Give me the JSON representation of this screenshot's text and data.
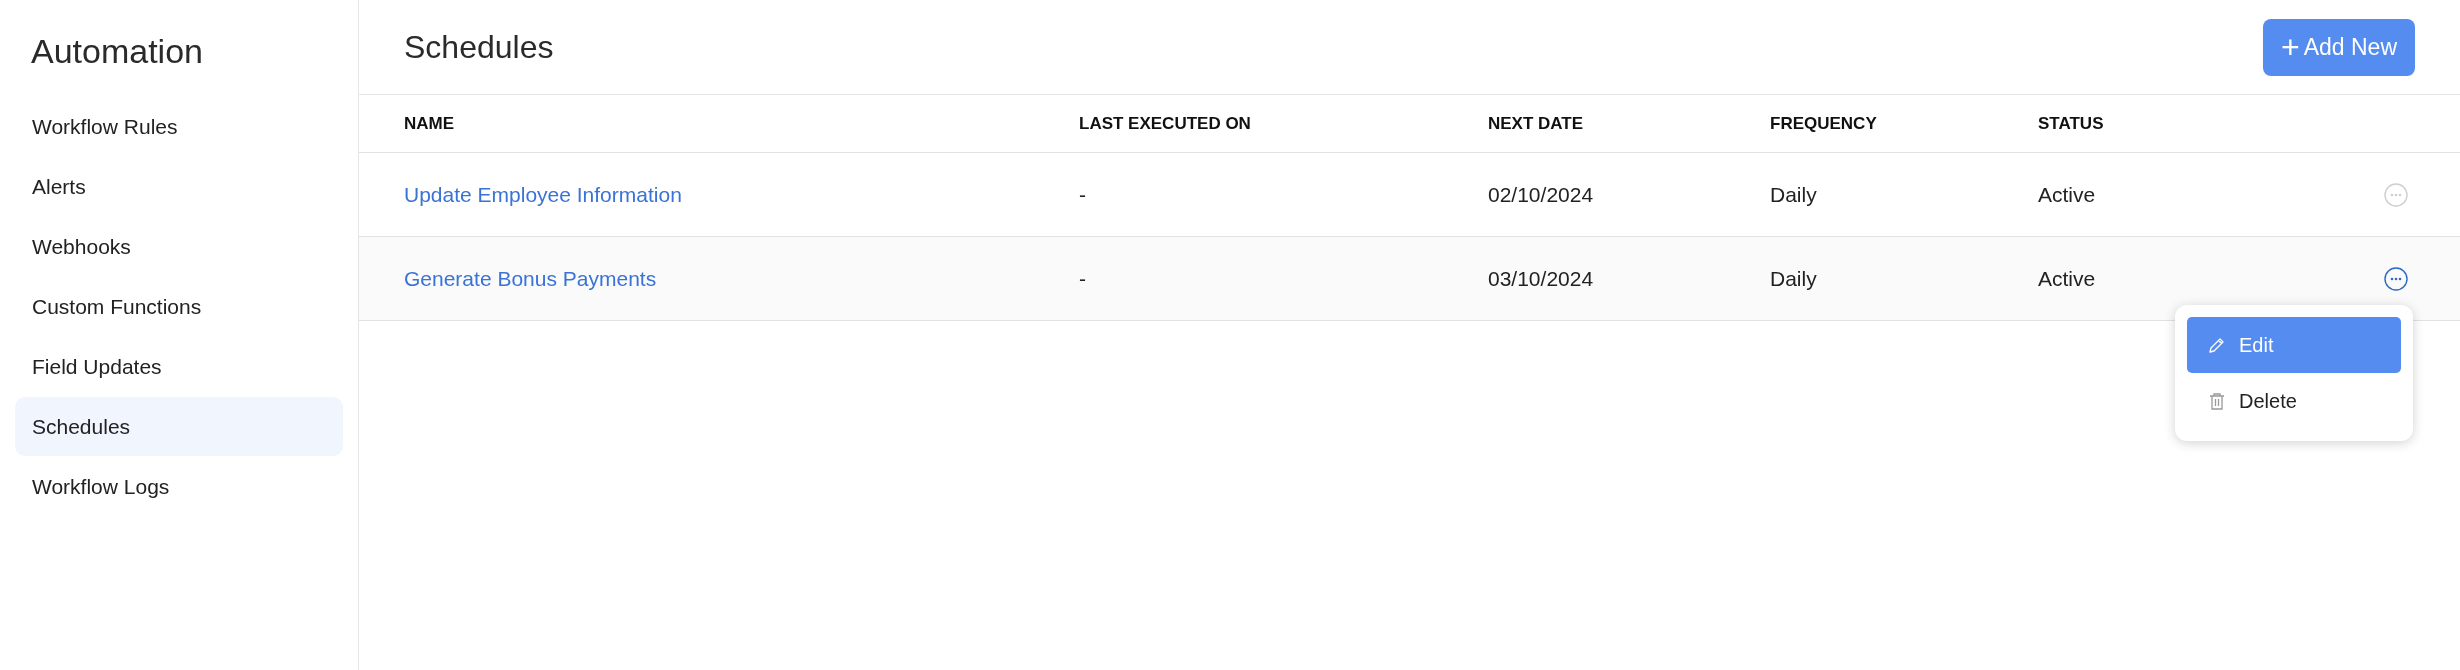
{
  "sidebar": {
    "title": "Automation",
    "items": [
      {
        "label": "Workflow Rules",
        "selected": false
      },
      {
        "label": "Alerts",
        "selected": false
      },
      {
        "label": "Webhooks",
        "selected": false
      },
      {
        "label": "Custom Functions",
        "selected": false
      },
      {
        "label": "Field Updates",
        "selected": false
      },
      {
        "label": "Schedules",
        "selected": true
      },
      {
        "label": "Workflow Logs",
        "selected": false
      }
    ]
  },
  "header": {
    "title": "Schedules",
    "add_button": {
      "icon": "+",
      "label": "Add New"
    }
  },
  "table": {
    "columns": [
      "NAME",
      "LAST EXECUTED ON",
      "NEXT DATE",
      "FREQUENCY",
      "STATUS"
    ],
    "rows": [
      {
        "name": "Update Employee Information",
        "last_executed_on": "-",
        "next_date": "02/10/2024",
        "frequency": "Daily",
        "status": "Active",
        "menu_open": false
      },
      {
        "name": "Generate Bonus Payments",
        "last_executed_on": "-",
        "next_date": "03/10/2024",
        "frequency": "Daily",
        "status": "Active",
        "menu_open": true
      }
    ]
  },
  "row_menu": {
    "items": [
      {
        "kind": "edit",
        "label": "Edit",
        "selected": true
      },
      {
        "kind": "delete",
        "label": "Delete",
        "selected": false
      }
    ]
  }
}
